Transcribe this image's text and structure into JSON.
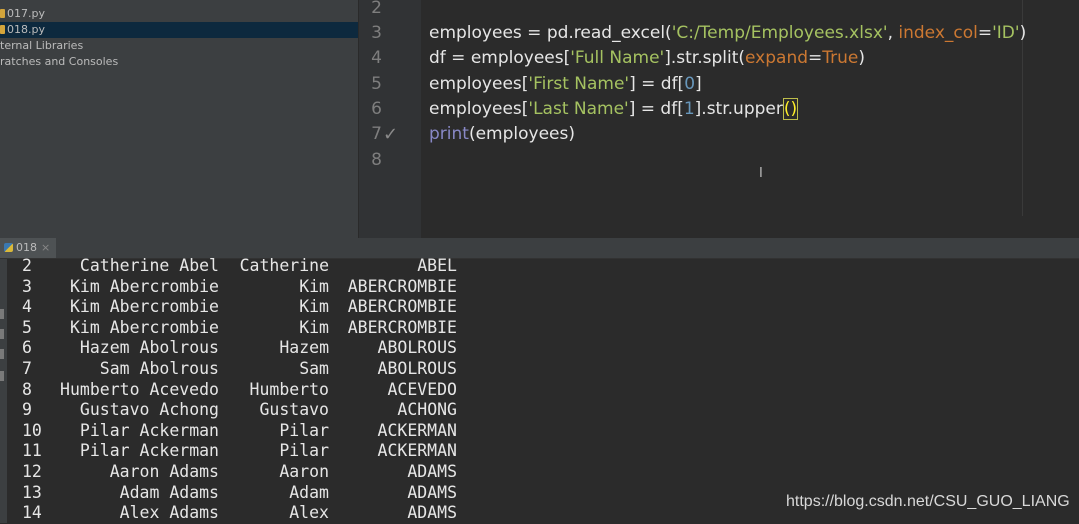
{
  "project_tree": {
    "items": [
      {
        "label": "017.py",
        "selected": false
      },
      {
        "label": "018.py",
        "selected": true
      },
      {
        "label": "ternal Libraries",
        "selected": false
      },
      {
        "label": "ratches and Consoles",
        "selected": false
      }
    ]
  },
  "editor": {
    "line_numbers": [
      "2",
      "3",
      "4",
      "5",
      "6",
      "7",
      "8"
    ],
    "code": {
      "l3": {
        "a": "employees = pd.read_excel(",
        "b": "'C:/Temp/Employees.xlsx'",
        "c": ", ",
        "d": "index_col",
        "e": "=",
        "f": "'ID'",
        "g": ")"
      },
      "l4": {
        "a": "df = employees[",
        "b": "'Full Name'",
        "c": "].str.split(",
        "d": "expand",
        "e": "=",
        "f": "True",
        "g": ")"
      },
      "l5": {
        "a": "employees[",
        "b": "'First Name'",
        "c": "] = df[",
        "d": "0",
        "e": "]"
      },
      "l6": {
        "a": "employees[",
        "b": "'Last Name'",
        "c": "] = df[",
        "d": "1",
        "e": "].str.upper",
        "f": "()"
      },
      "l7": {
        "a": "print",
        "b": "(employees)"
      }
    },
    "caret_glyph": "I"
  },
  "run_panel": {
    "tab_label": "018",
    "close_glyph": "×",
    "rows": [
      {
        "idx": "2",
        "full": "Catherine Abel",
        "first": "Catherine",
        "last": "ABEL"
      },
      {
        "idx": "3",
        "full": "Kim Abercrombie",
        "first": "Kim",
        "last": "ABERCROMBIE"
      },
      {
        "idx": "4",
        "full": "Kim Abercrombie",
        "first": "Kim",
        "last": "ABERCROMBIE"
      },
      {
        "idx": "5",
        "full": "Kim Abercrombie",
        "first": "Kim",
        "last": "ABERCROMBIE"
      },
      {
        "idx": "6",
        "full": "Hazem Abolrous",
        "first": "Hazem",
        "last": "ABOLROUS"
      },
      {
        "idx": "7",
        "full": "Sam Abolrous",
        "first": "Sam",
        "last": "ABOLROUS"
      },
      {
        "idx": "8",
        "full": "Humberto Acevedo",
        "first": "Humberto",
        "last": "ACEVEDO"
      },
      {
        "idx": "9",
        "full": "Gustavo Achong",
        "first": "Gustavo",
        "last": "ACHONG"
      },
      {
        "idx": "10",
        "full": "Pilar Ackerman",
        "first": "Pilar",
        "last": "ACKERMAN"
      },
      {
        "idx": "11",
        "full": "Pilar Ackerman",
        "first": "Pilar",
        "last": "ACKERMAN"
      },
      {
        "idx": "12",
        "full": "Aaron Adams",
        "first": "Aaron",
        "last": "ADAMS"
      },
      {
        "idx": "13",
        "full": "Adam Adams",
        "first": "Adam",
        "last": "ADAMS"
      },
      {
        "idx": "14",
        "full": "Alex Adams",
        "first": "Alex",
        "last": "ADAMS"
      }
    ]
  },
  "watermark": "https://blog.csdn.net/CSU_GUO_LIANG",
  "colors": {
    "background": "#2b2b2b",
    "string": "#a5c261",
    "keyword_arg": "#cc7832",
    "number": "#6897bb",
    "builtin": "#8888c6",
    "selection": "#0d293e"
  }
}
